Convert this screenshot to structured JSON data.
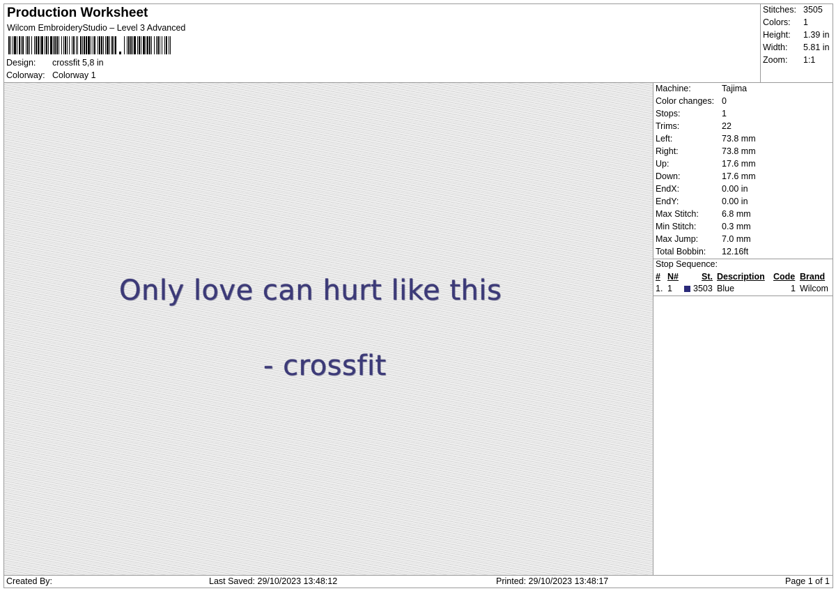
{
  "header": {
    "title": "Production Worksheet",
    "subtitle": "Wilcom EmbroideryStudio – Level 3 Advanced",
    "design_label": "Design:",
    "design_value": "crossfit 5,8 in",
    "colorway_label": "Colorway:",
    "colorway_value": "Colorway 1"
  },
  "stats": [
    {
      "label": "Stitches:",
      "value": "3505"
    },
    {
      "label": "Colors:",
      "value": "1"
    },
    {
      "label": "Height:",
      "value": "1.39 in"
    },
    {
      "label": "Width:",
      "value": "5.81 in"
    },
    {
      "label": "Zoom:",
      "value": "1:1"
    }
  ],
  "machine_info": [
    {
      "label": "Machine:",
      "value": "Tajima"
    },
    {
      "label": "Color changes:",
      "value": "0"
    },
    {
      "label": "Stops:",
      "value": "1"
    },
    {
      "label": "Trims:",
      "value": "22"
    },
    {
      "label": "Left:",
      "value": "73.8 mm"
    },
    {
      "label": "Right:",
      "value": "73.8 mm"
    },
    {
      "label": "Up:",
      "value": "17.6 mm"
    },
    {
      "label": "Down:",
      "value": "17.6 mm"
    },
    {
      "label": "EndX:",
      "value": "0.00 in"
    },
    {
      "label": "EndY:",
      "value": "0.00 in"
    },
    {
      "label": "Max Stitch:",
      "value": "6.8 mm"
    },
    {
      "label": "Min Stitch:",
      "value": "0.3 mm"
    },
    {
      "label": "Max Jump:",
      "value": "7.0 mm"
    },
    {
      "label": "Total Bobbin:",
      "value": "12.16ft"
    }
  ],
  "stop_sequence": {
    "title": "Stop Sequence:",
    "columns": [
      "#",
      "N#",
      "St.",
      "Description",
      "Code",
      "Brand"
    ],
    "rows": [
      {
        "index": "1.",
        "needle": "1",
        "stitches": "3503",
        "description": "Blue",
        "code": "1",
        "brand": "Wilcom",
        "color": "#2b2a7a"
      }
    ]
  },
  "design_text": {
    "line1": "Only love can hurt like this",
    "line2": "- crossfit",
    "thread_color": "#3c3a78",
    "fabric_color": "#e6e6e6"
  },
  "footer": {
    "created_by": "Created By:",
    "last_saved": "Last Saved: 29/10/2023 13:48:12",
    "printed": "Printed: 29/10/2023 13:48:17",
    "page": "Page 1 of 1"
  }
}
